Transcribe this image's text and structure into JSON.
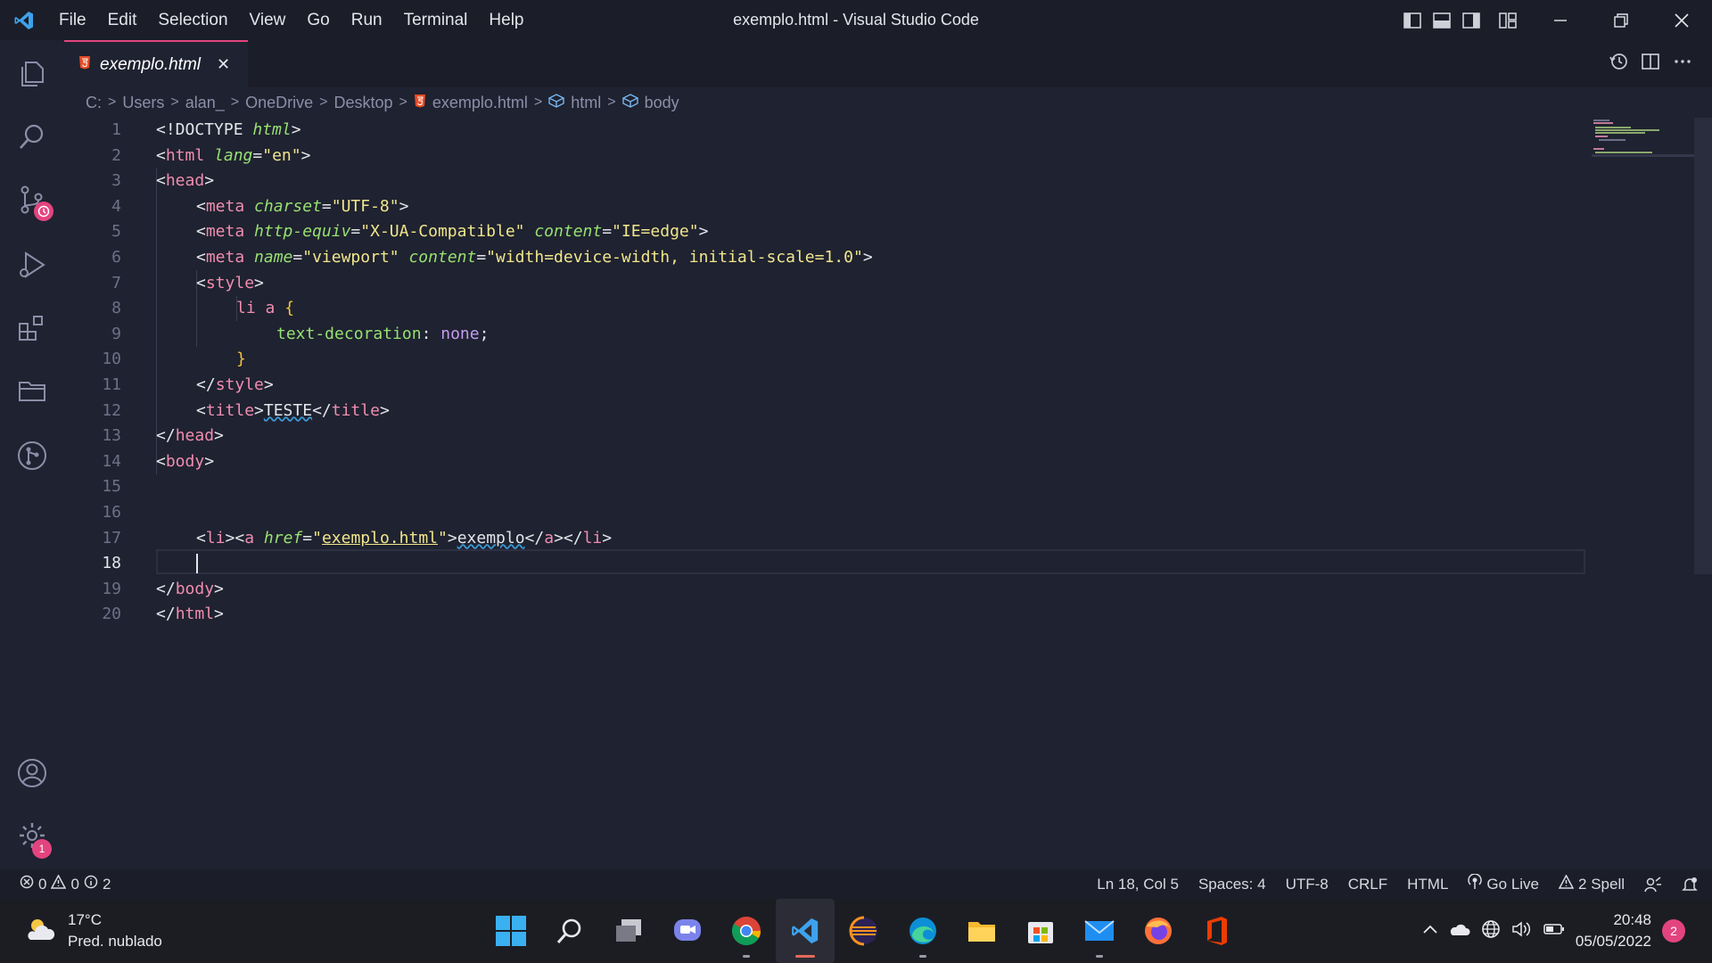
{
  "app": {
    "window_title": "exemplo.html - Visual Studio Code",
    "menu": [
      "File",
      "Edit",
      "Selection",
      "View",
      "Go",
      "Run",
      "Terminal",
      "Help"
    ]
  },
  "tab": {
    "label": "exemplo.html",
    "close": "✕"
  },
  "breadcrumb": {
    "parts": [
      "C:",
      "Users",
      "alan_",
      "OneDrive",
      "Desktop",
      "exemplo.html",
      "html",
      "body"
    ],
    "separator": ">"
  },
  "editor": {
    "cursor_line": 18,
    "lines": [
      "1",
      "2",
      "3",
      "4",
      "5",
      "6",
      "7",
      "8",
      "9",
      "10",
      "11",
      "12",
      "13",
      "14",
      "15",
      "16",
      "17",
      "18",
      "19",
      "20"
    ]
  },
  "code": {
    "l1": [
      "<!DOCTYPE ",
      "html",
      ">"
    ],
    "l2": [
      "<",
      "html",
      " ",
      "lang",
      "=",
      "\"en\"",
      ">"
    ],
    "l3": [
      "<",
      "head",
      ">"
    ],
    "l4": [
      "<",
      "meta",
      " ",
      "charset",
      "=",
      "\"UTF-8\"",
      ">"
    ],
    "l5": [
      "<",
      "meta",
      " ",
      "http-equiv",
      "=",
      "\"X-UA-Compatible\"",
      " ",
      "content",
      "=",
      "\"IE=edge\"",
      ">"
    ],
    "l6": [
      "<",
      "meta",
      " ",
      "name",
      "=",
      "\"viewport\"",
      " ",
      "content",
      "=",
      "\"width=device-width, initial-scale=1.0\"",
      ">"
    ],
    "l7": [
      "<",
      "style",
      ">"
    ],
    "l8": [
      "li a ",
      "{"
    ],
    "l9": [
      "text-decoration",
      ": ",
      "none",
      ";"
    ],
    "l10": [
      "}"
    ],
    "l11": [
      "</",
      "style",
      ">"
    ],
    "l12": [
      "<",
      "title",
      ">",
      "TESTE",
      "</",
      "title",
      ">"
    ],
    "l13": [
      "</",
      "head",
      ">"
    ],
    "l14": [
      "<",
      "body",
      ">"
    ],
    "l17": [
      "<",
      "li",
      "><",
      "a",
      " ",
      "href",
      "=",
      "\"",
      "exemplo.html",
      "\"",
      ">",
      "exemplo",
      "</",
      "a",
      "></",
      "li",
      ">"
    ],
    "l19": [
      "</",
      "body",
      ">"
    ],
    "l20": [
      "</",
      "html",
      ">"
    ]
  },
  "status": {
    "errors": "0",
    "warnings": "0",
    "infos": "2",
    "position": "Ln 18, Col 5",
    "spaces": "Spaces: 4",
    "encoding": "UTF-8",
    "eol": "CRLF",
    "language": "HTML",
    "golive": "Go Live",
    "spell": "2 Spell"
  },
  "activity": {
    "source_control_badge": "",
    "settings_badge": "1"
  },
  "taskbar": {
    "temperature": "17°C",
    "weather": "Pred. nublado",
    "time": "20:48",
    "date": "05/05/2022",
    "notifications": "2"
  },
  "colors": {
    "accent": "#e3447f",
    "tag": "#f08db0",
    "attr": "#97e072",
    "string": "#f0e68c"
  }
}
